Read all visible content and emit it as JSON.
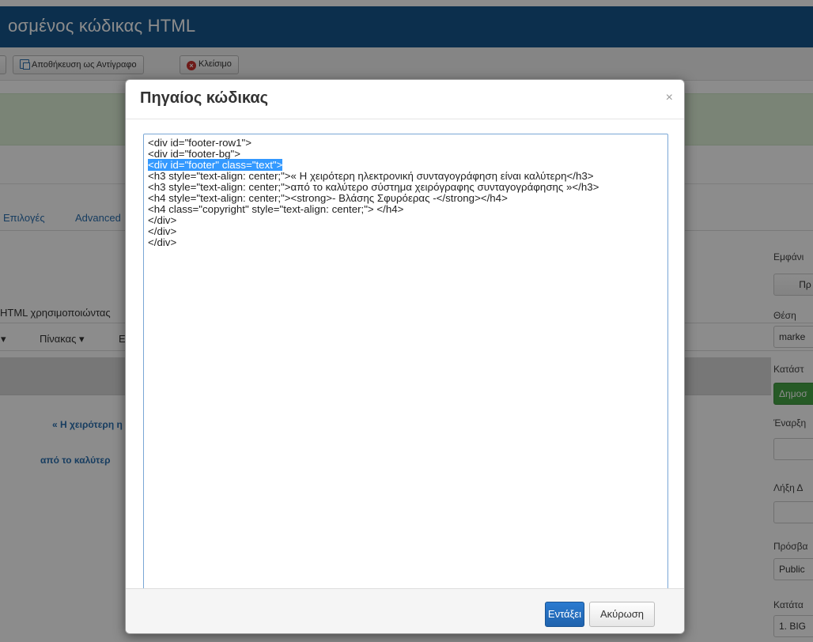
{
  "page": {
    "title": "οσμένος κώδικας HTML"
  },
  "toolbar": {
    "save_copy_label": "Αποθήκευση ως Αντίγραφο",
    "close_label": "Κλείσιμο"
  },
  "tabs": {
    "options_label": "Επιλογές",
    "advanced_label": "Advanced"
  },
  "editor": {
    "intro_label": "ΗTML χρησιμοποιώντας",
    "menu_table": "Πίνακας ▾",
    "menu_prev": "▾",
    "menu_next": "Ε",
    "preview_line1": "« Η χειρότερη η",
    "preview_line2": "από το καλύτερ"
  },
  "right_panel": {
    "display_label": "Εμφάνι",
    "display_btn": "Πρ",
    "position_label": "Θέση",
    "position_value": "marke",
    "status_label": "Κατάστ",
    "status_value": "Δημοσ",
    "start_label": "Έναρξη",
    "end_label": "Λήξη Δ",
    "access_label": "Πρόσβα",
    "access_value": "Public",
    "order_label": "Κατάτα",
    "order_value": "1. BIG"
  },
  "modal": {
    "title": "Πηγαίος κώδικας",
    "close_symbol": "×",
    "code_lines": [
      "<div id=\"footer-row1\">",
      "<div id=\"footer-bg\">",
      "<div id=\"footer\" class=\"text\">",
      "<h3 style=\"text-align: center;\">« Η χειρότερη ηλεκτρονική συνταγογράφηση είναι καλύτερη</h3>",
      "<h3 style=\"text-align: center;\">από το καλύτερο σύστημα χειρόγραφης συνταγογράφησης »</h3>",
      "<h4 style=\"text-align: center;\"><strong>- Βλάσης Σφυρόερας -</strong></h4>",
      "<h4 class=\"copyright\" style=\"text-align: center;\"> </h4>",
      "</div>",
      "</div>",
      "</div>"
    ],
    "selected_line_index": 2,
    "insert_label": "Εντάξει",
    "cancel_label": "Ακύρωση"
  },
  "colors": {
    "topbar": "#17568c",
    "success_bar": "#dff0d8",
    "primary_button": "#2b7bd0",
    "selection": "#3399ff"
  }
}
